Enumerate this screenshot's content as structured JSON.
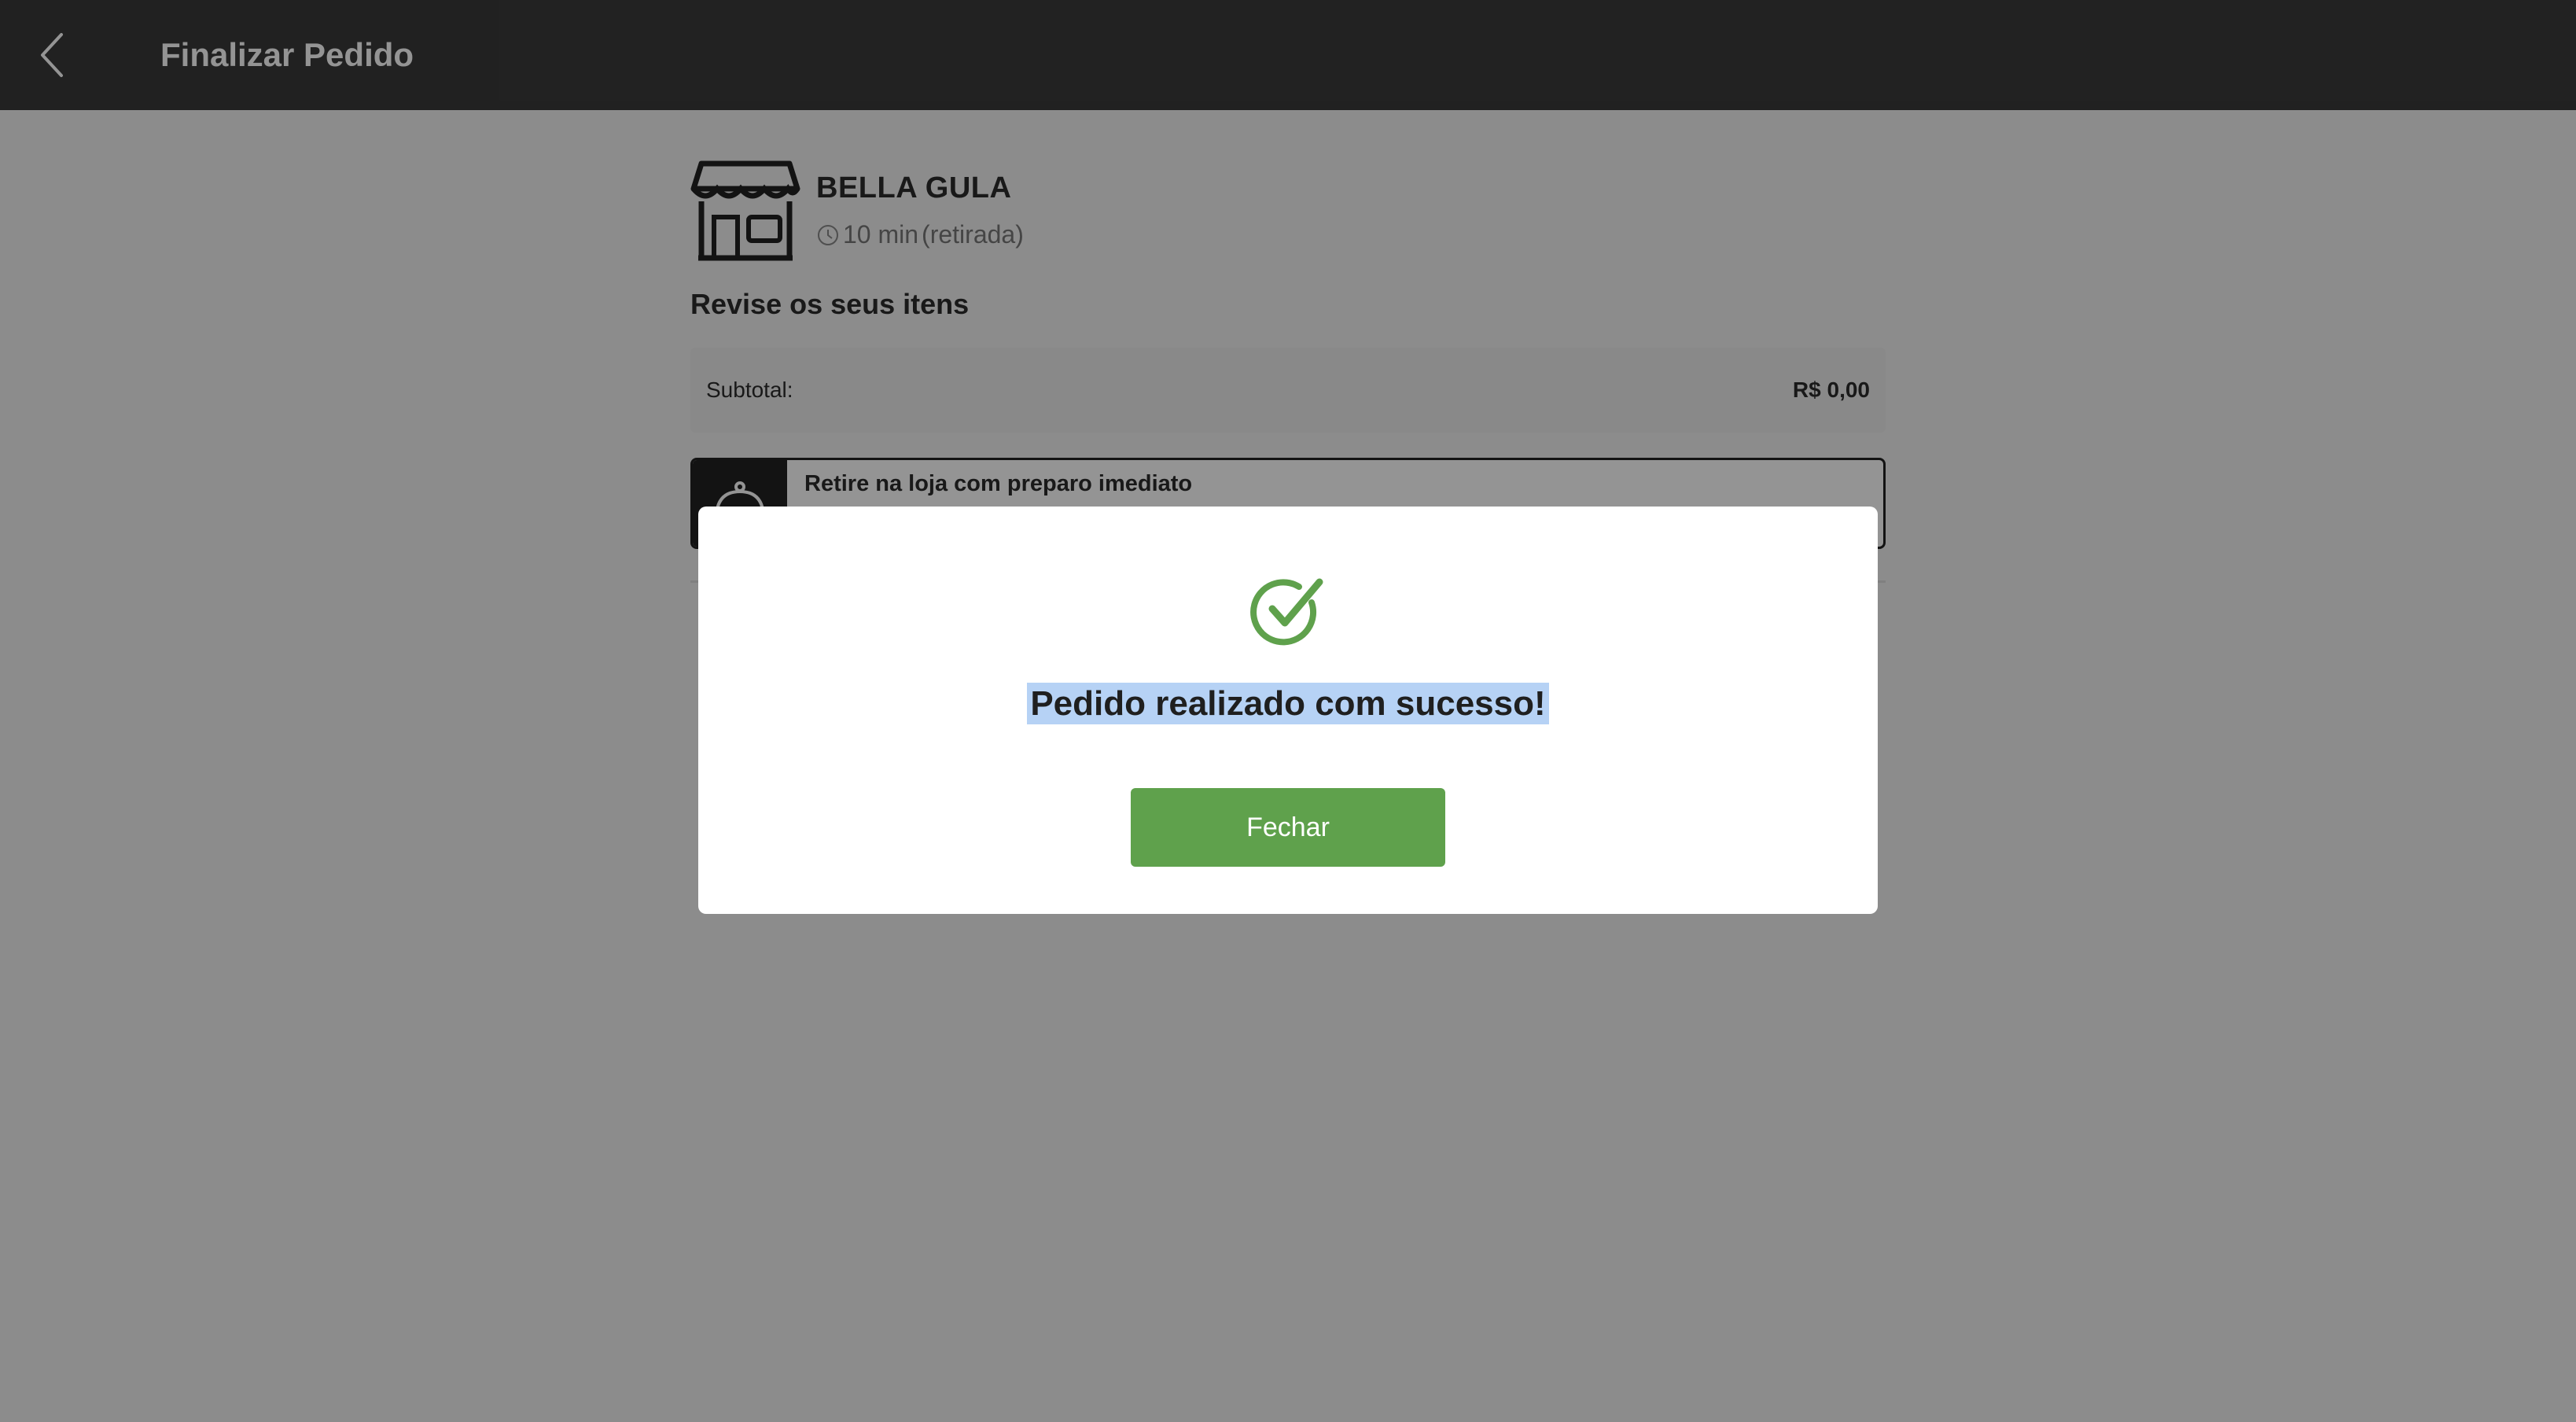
{
  "header": {
    "title": "Finalizar Pedido",
    "back_icon": "chevron-left-icon"
  },
  "store": {
    "name": "BELLA GULA",
    "icon": "storefront-icon",
    "time": "10 min",
    "mode": "(retirada)"
  },
  "review": {
    "title": "Revise os seus itens",
    "subtotal_label": "Subtotal:",
    "subtotal_value": "R$ 0,00"
  },
  "pickup": {
    "label": "Retire na loja com preparo imediato",
    "icon": "cloche-icon"
  },
  "modal": {
    "message": "Pedido realizado com sucesso!",
    "button_label": "Fechar",
    "icon": "check-circle-icon"
  },
  "colors": {
    "topbar": "#3a3a3a",
    "success_green": "#5fa14c",
    "selection_highlight": "#b6d2f5"
  }
}
